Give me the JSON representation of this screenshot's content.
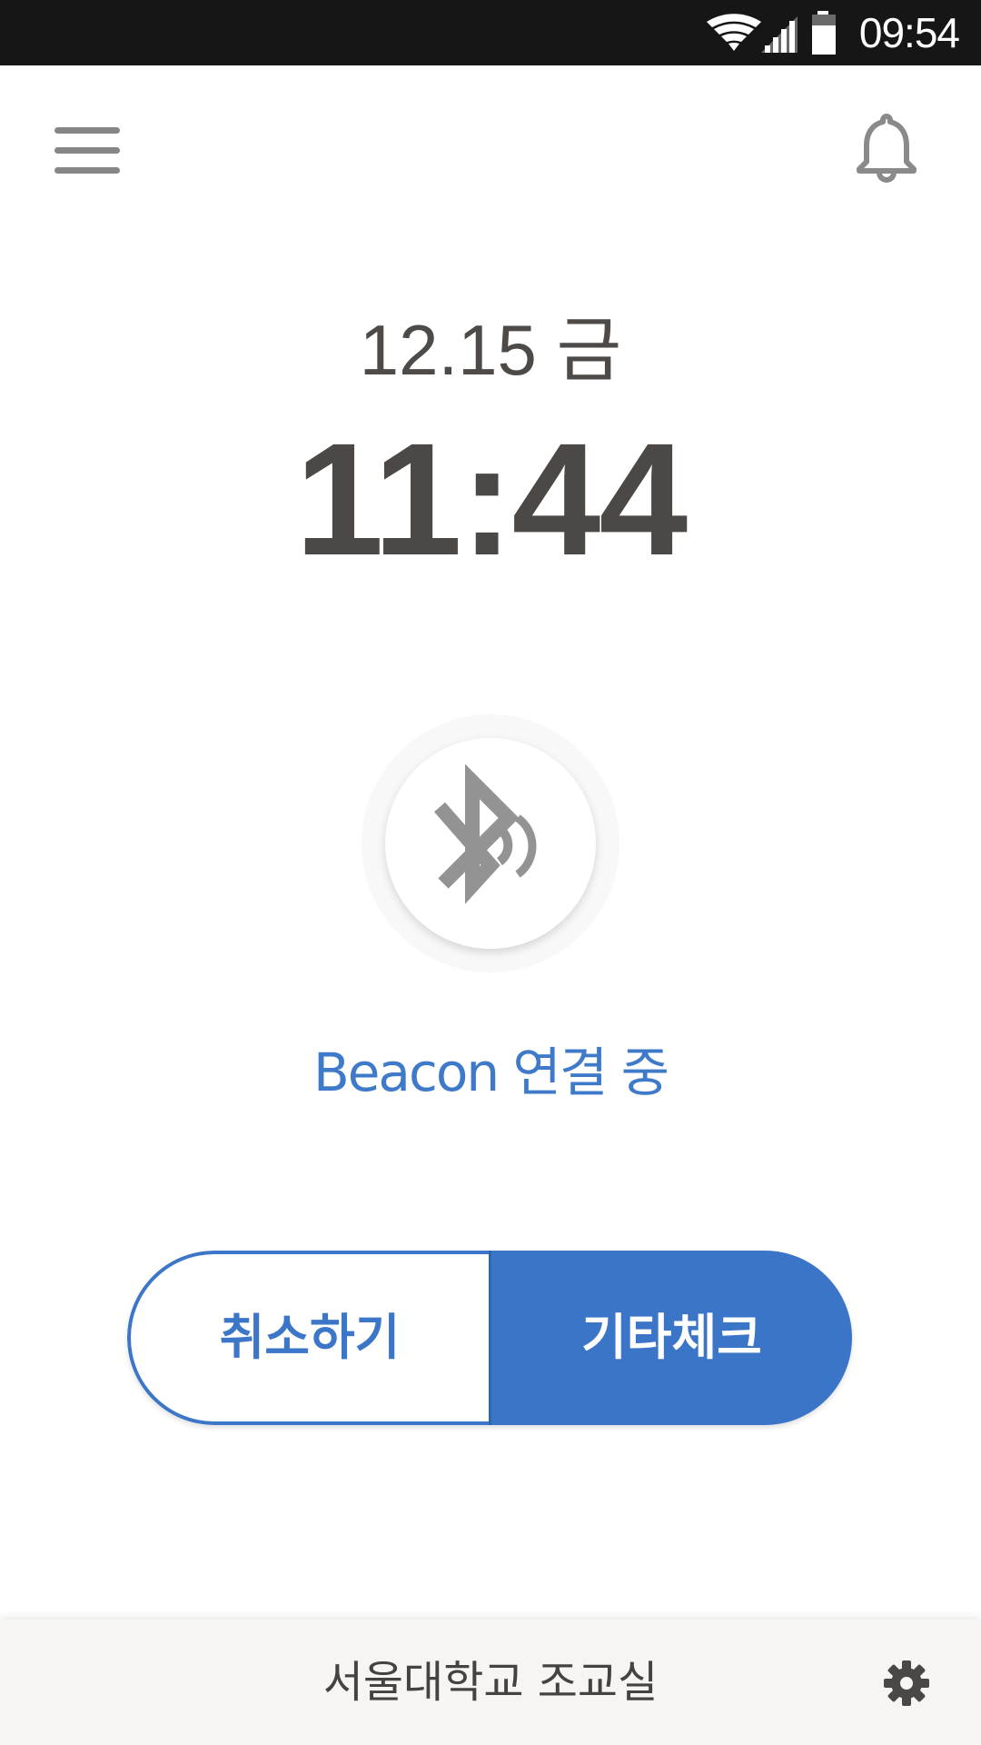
{
  "status_bar": {
    "time": "09:54",
    "icons": [
      "wifi-icon",
      "signal-icon",
      "battery-icon"
    ]
  },
  "app_bar": {
    "menu_icon": "hamburger-menu-icon",
    "notification_icon": "bell-icon"
  },
  "clock": {
    "date": "12.15 금",
    "time": "11:44"
  },
  "beacon": {
    "icon": "bluetooth-searching-icon",
    "status": "Beacon 연결 중"
  },
  "actions": {
    "cancel_label": "취소하기",
    "other_check_label": "기타체크"
  },
  "footer": {
    "title": "서울대학교 조교실",
    "settings_icon": "gear-icon"
  },
  "colors": {
    "accent": "#3a75c8",
    "status_bar_bg": "#161616",
    "text_dark": "#4c4846",
    "icon_gray": "#868686",
    "footer_bg": "#f6f5f4"
  }
}
